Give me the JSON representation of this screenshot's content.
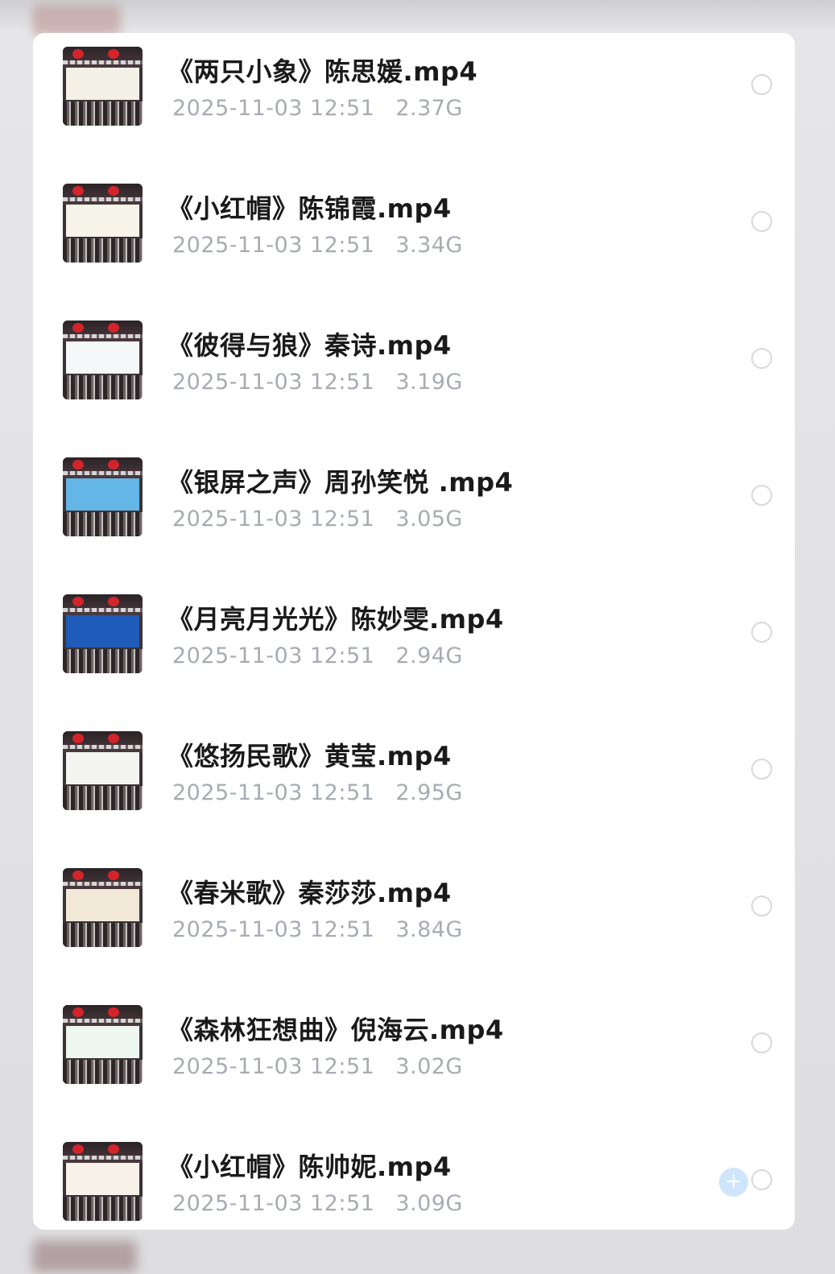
{
  "files": [
    {
      "name": "《两只小象》陈思媛.mp4",
      "date": "2025-11-03 12:51",
      "size": "2.37G",
      "screen_color": "#f3f0e6"
    },
    {
      "name": "《小红帽》陈锦霞.mp4",
      "date": "2025-11-03 12:51",
      "size": "3.34G",
      "screen_color": "#f6f4e9"
    },
    {
      "name": "《彼得与狼》秦诗.mp4",
      "date": "2025-11-03 12:51",
      "size": "3.19G",
      "screen_color": "#f5f7f9"
    },
    {
      "name": "《银屏之声》周孙笑悦 .mp4",
      "date": "2025-11-03 12:51",
      "size": "3.05G",
      "screen_color": "#63b6e6"
    },
    {
      "name": "《月亮月光光》陈妙雯.mp4",
      "date": "2025-11-03 12:51",
      "size": "2.94G",
      "screen_color": "#1f5bb8"
    },
    {
      "name": "《悠扬民歌》黄莹.mp4",
      "date": "2025-11-03 12:51",
      "size": "2.95G",
      "screen_color": "#f4f4f1"
    },
    {
      "name": "《春米歌》秦莎莎.mp4",
      "date": "2025-11-03 12:51",
      "size": "3.84G",
      "screen_color": "#f2e8d8"
    },
    {
      "name": "《森林狂想曲》倪海云.mp4",
      "date": "2025-11-03 12:51",
      "size": "3.02G",
      "screen_color": "#eef6f2"
    },
    {
      "name": "《小红帽》陈帅妮.mp4",
      "date": "2025-11-03 12:51",
      "size": "3.09G",
      "screen_color": "#f7f1ea"
    }
  ],
  "fab": {
    "icon": "plus-icon",
    "glyph": "+"
  },
  "colors": {
    "title": "#1a1a1a",
    "meta": "#a8abb2",
    "radio_border": "#d8d9dc",
    "fab": "#cfe5fb"
  }
}
